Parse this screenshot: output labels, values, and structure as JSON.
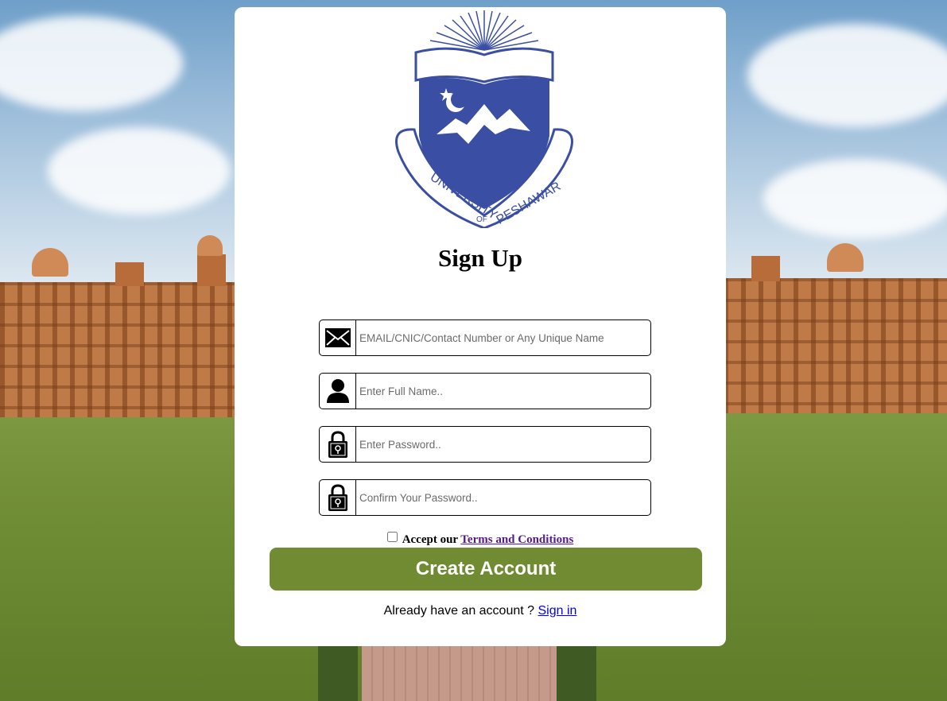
{
  "logo": {
    "text_top": "UNIVERSITY",
    "text_of": "OF",
    "text_bottom": "PESHAWAR",
    "color": "#3a4ea3"
  },
  "title": "Sign Up",
  "fields": [
    {
      "icon": "envelope-icon",
      "placeholder": "EMAIL/CNIC/Contact Number or Any Unique Name",
      "value": ""
    },
    {
      "icon": "user-icon",
      "placeholder": "Enter Full Name..",
      "value": ""
    },
    {
      "icon": "lock-icon",
      "placeholder": "Enter Password..",
      "value": ""
    },
    {
      "icon": "lock-icon",
      "placeholder": "Confirm Your Password..",
      "value": ""
    }
  ],
  "terms": {
    "prefix": "Accept our",
    "link": "Terms and Conditions",
    "checked": false
  },
  "create_button": "Create Account",
  "signin": {
    "text": "Already have an account ?",
    "link": "Sign in"
  },
  "colors": {
    "button": "#708b32",
    "link_visited": "#551a8b",
    "link": "#0000ee"
  }
}
